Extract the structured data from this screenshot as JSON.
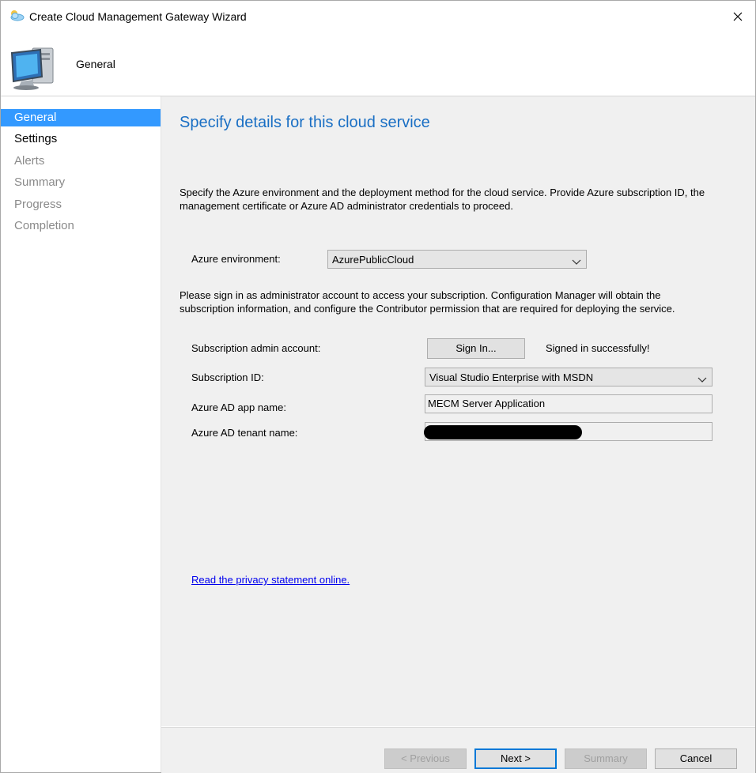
{
  "window": {
    "title": "Create Cloud Management Gateway Wizard"
  },
  "header": {
    "title": "General"
  },
  "nav": {
    "items": [
      {
        "label": "General",
        "state": "active"
      },
      {
        "label": "Settings",
        "state": "current"
      },
      {
        "label": "Alerts",
        "state": "disabled"
      },
      {
        "label": "Summary",
        "state": "disabled"
      },
      {
        "label": "Progress",
        "state": "disabled"
      },
      {
        "label": "Completion",
        "state": "disabled"
      }
    ]
  },
  "main": {
    "heading": "Specify details for this cloud service",
    "description": "Specify the Azure environment and the deployment method for the cloud service. Provide Azure subscription ID, the management certificate or Azure AD administrator credentials to proceed.",
    "azure_env_label": "Azure environment:",
    "azure_env_value": "AzurePublicCloud",
    "signin_description": "Please sign in as administrator account to access your subscription. Configuration Manager will obtain the subscription information, and configure the Contributor permission that are required for deploying the service.",
    "sub_admin_label": "Subscription admin account:",
    "sign_in_button": "Sign In...",
    "sign_in_status": "Signed in successfully!",
    "sub_id_label": "Subscription ID:",
    "sub_id_value": "Visual Studio Enterprise with MSDN",
    "app_name_label": "Azure AD app name:",
    "app_name_value": "MECM Server Application",
    "tenant_label": "Azure AD tenant name:",
    "tenant_value": "",
    "privacy_link": "Read the privacy statement online."
  },
  "footer": {
    "previous": "< Previous",
    "next": "Next >",
    "summary": "Summary",
    "cancel": "Cancel"
  },
  "colors": {
    "accent": "#3399ff",
    "heading": "#1a6fc4",
    "link": "#0000ee",
    "panel": "#f0f0f0"
  },
  "icons": [
    "cloud-wizard-icon",
    "close-icon",
    "computer-icon",
    "chevron-down-icon"
  ]
}
